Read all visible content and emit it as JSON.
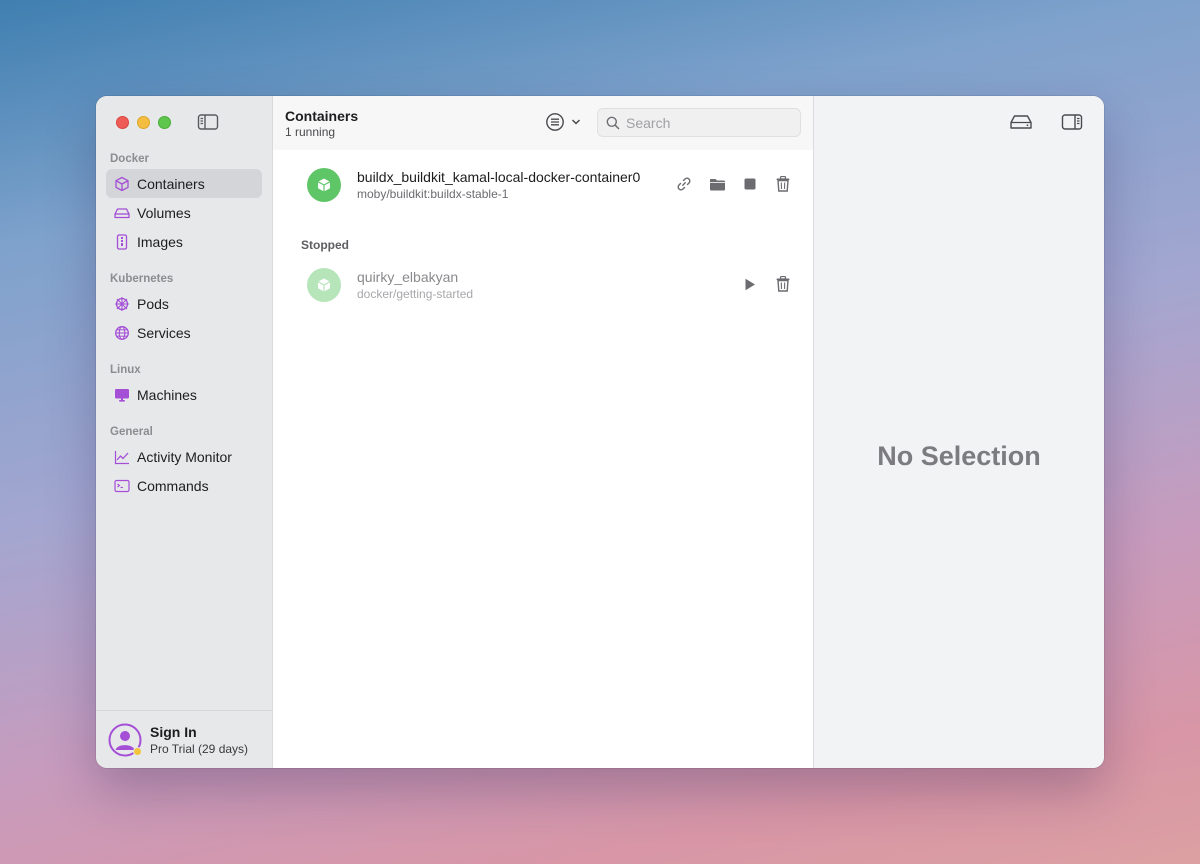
{
  "sidebar": {
    "sections": [
      {
        "title": "Docker",
        "items": [
          {
            "label": "Containers",
            "icon": "cube-icon",
            "active": true
          },
          {
            "label": "Volumes",
            "icon": "drive-icon"
          },
          {
            "label": "Images",
            "icon": "archive-icon"
          }
        ]
      },
      {
        "title": "Kubernetes",
        "items": [
          {
            "label": "Pods",
            "icon": "helm-wheel-icon"
          },
          {
            "label": "Services",
            "icon": "globe-icon"
          }
        ]
      },
      {
        "title": "Linux",
        "items": [
          {
            "label": "Machines",
            "icon": "monitor-icon"
          }
        ]
      },
      {
        "title": "General",
        "items": [
          {
            "label": "Activity Monitor",
            "icon": "chart-line-icon"
          },
          {
            "label": "Commands",
            "icon": "terminal-icon"
          }
        ]
      }
    ],
    "footer": {
      "title": "Sign In",
      "subtitle": "Pro Trial (29 days)"
    }
  },
  "header": {
    "title": "Containers",
    "subtitle": "1 running"
  },
  "search": {
    "placeholder": "Search",
    "value": ""
  },
  "containers": {
    "running": [
      {
        "name": "buildx_buildkit_kamal-local-docker-container0",
        "image": "moby/buildkit:buildx-stable-1"
      }
    ],
    "stopped_label": "Stopped",
    "stopped": [
      {
        "name": "quirky_elbakyan",
        "image": "docker/getting-started"
      }
    ]
  },
  "detail": {
    "empty_text": "No Selection"
  },
  "colors": {
    "accent": "#a44fd6",
    "running_green": "#5fc668",
    "traffic_red": "#ee5d55",
    "traffic_yellow": "#f4bd3f",
    "traffic_green": "#5fc64d"
  }
}
